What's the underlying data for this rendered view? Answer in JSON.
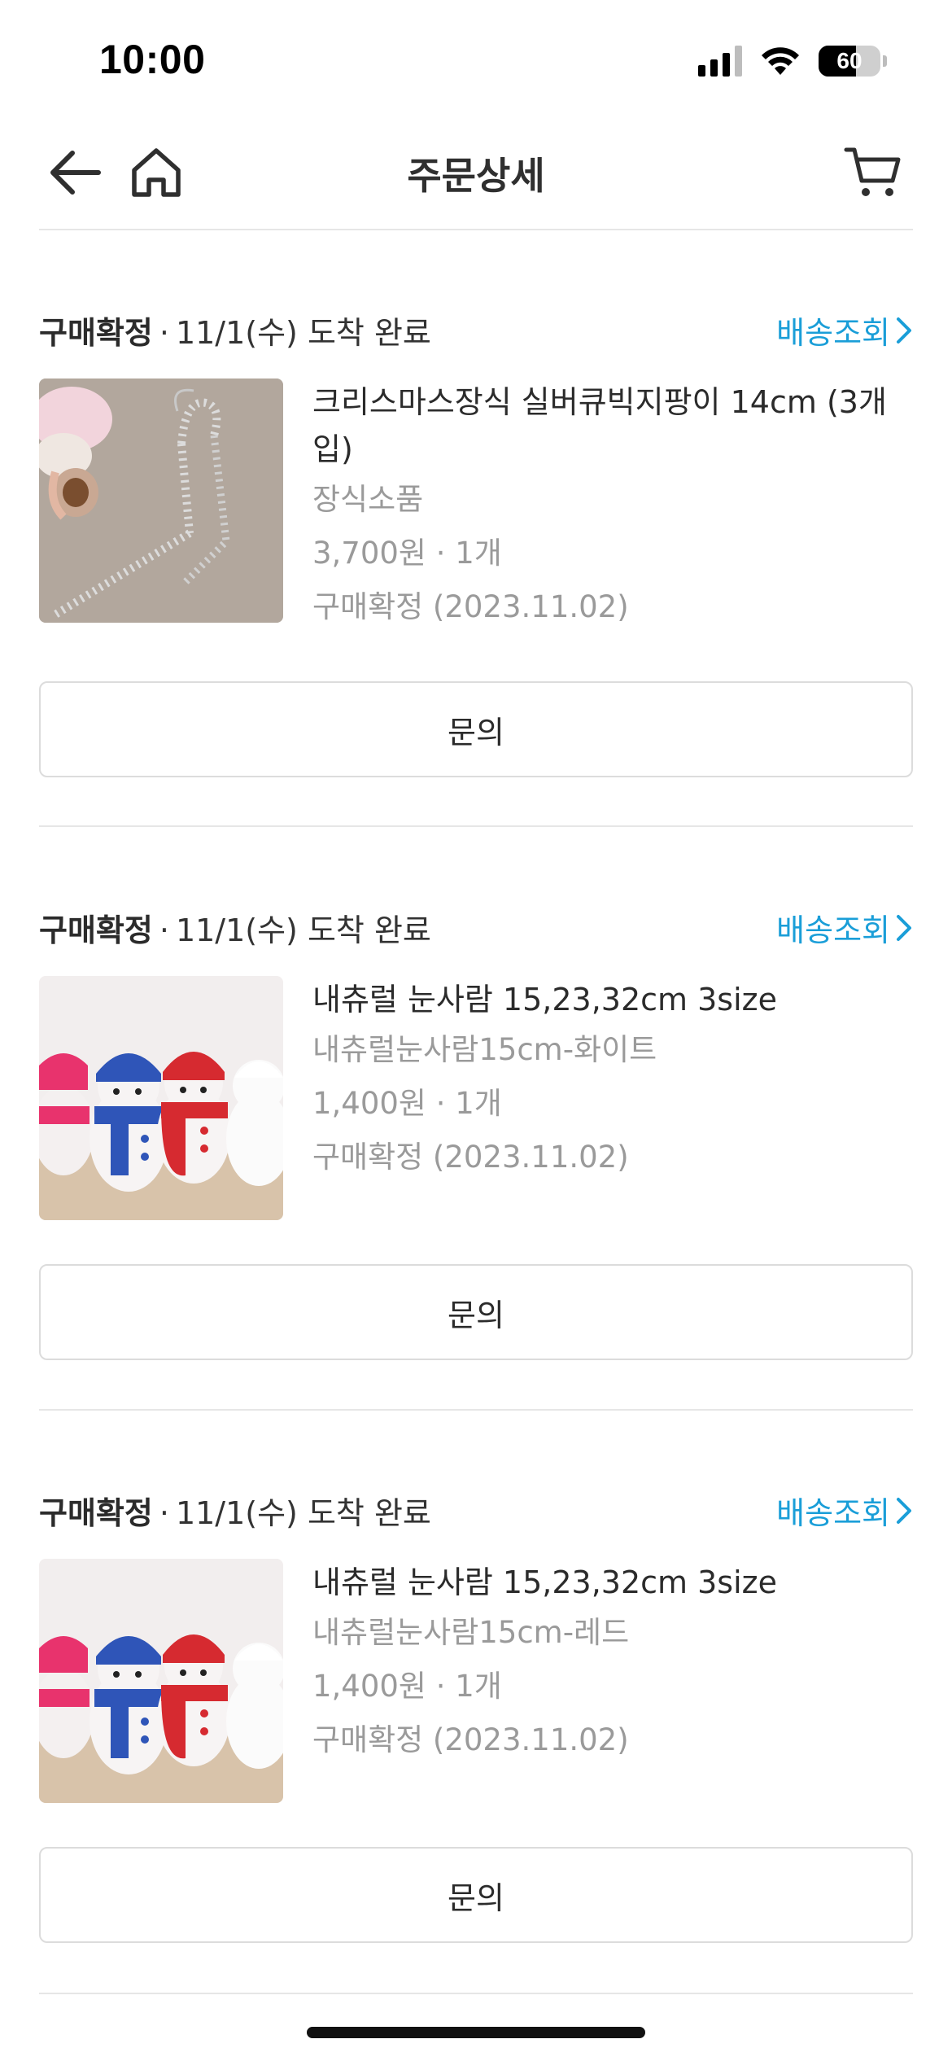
{
  "status_bar": {
    "time": "10:00",
    "battery": "60",
    "battery_level_percent": 60
  },
  "header": {
    "title": "주문상세"
  },
  "orders": [
    {
      "status_strong": "구매확정",
      "status_rest": "11/1(수) 도착 완료",
      "tracking_label": "배송조회",
      "product_name": "크리스마스장식 실버큐빅지팡이 14cm (3개입)",
      "option": "장식소품",
      "price_qty": "3,700원 · 1개",
      "confirm": "구매확정 (2023.11.02)",
      "inquiry_label": "문의"
    },
    {
      "status_strong": "구매확정",
      "status_rest": "11/1(수) 도착 완료",
      "tracking_label": "배송조회",
      "product_name": "내츄럴 눈사람 15,23,32cm 3size",
      "option": "내츄럴눈사람15cm-화이트",
      "price_qty": "1,400원 · 1개",
      "confirm": "구매확정 (2023.11.02)",
      "inquiry_label": "문의"
    },
    {
      "status_strong": "구매확정",
      "status_rest": "11/1(수) 도착 완료",
      "tracking_label": "배송조회",
      "product_name": "내츄럴 눈사람 15,23,32cm 3size",
      "option": "내츄럴눈사람15cm-레드",
      "price_qty": "1,400원 · 1개",
      "confirm": "구매확정 (2023.11.02)",
      "inquiry_label": "문의"
    }
  ],
  "colors": {
    "accent_link": "#1a9ed8",
    "text_primary": "#2b2b2b",
    "text_muted": "#9a9a9a",
    "divider": "#e6e6e6"
  },
  "icons": [
    "back-arrow-icon",
    "home-icon",
    "cart-icon",
    "chevron-right-icon",
    "wifi-icon",
    "cellular-signal-icon",
    "battery-icon"
  ]
}
